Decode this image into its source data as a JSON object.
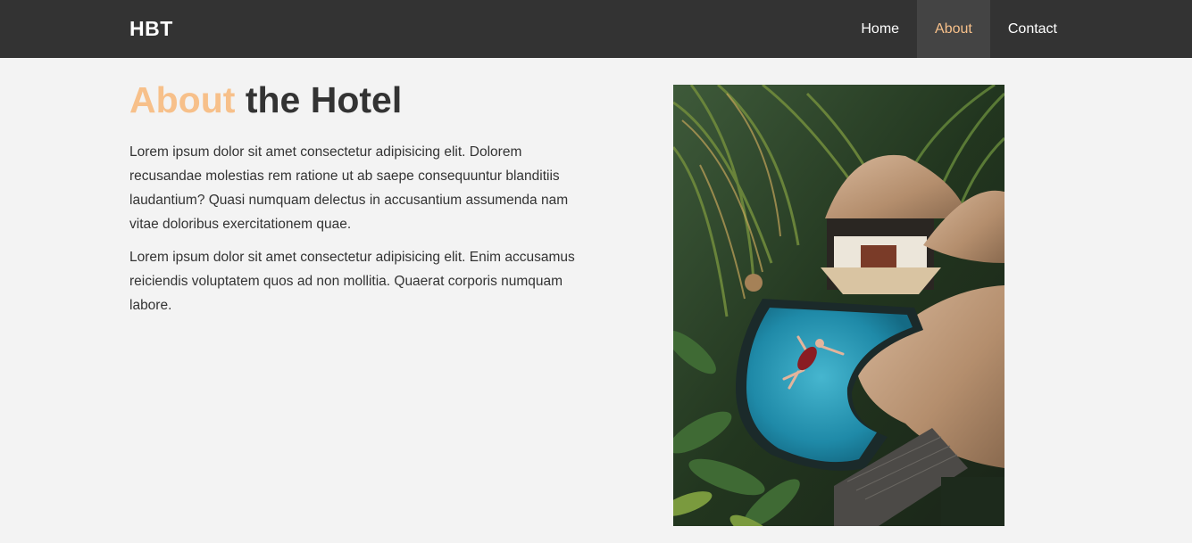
{
  "brand": "HBT",
  "nav": {
    "items": [
      {
        "label": "Home",
        "active": false
      },
      {
        "label": "About",
        "active": true
      },
      {
        "label": "Contact",
        "active": false
      }
    ]
  },
  "about": {
    "title_accent": "About",
    "title_rest": "the Hotel",
    "paragraphs": [
      "Lorem ipsum dolor sit amet consectetur adipisicing elit. Dolorem recusandae molestias rem ratione ut ab saepe consequuntur blanditiis laudantium? Quasi numquam delectus in accusantium assumenda nam vitae doloribus exercitationem quae.",
      "Lorem ipsum dolor sit amet consectetur adipisicing elit. Enim accusamus reiciendis voluptatem quos ad non mollitia. Quaerat corporis numquam labore."
    ]
  },
  "colors": {
    "navbar_bg": "#333333",
    "accent": "#f7c08a",
    "active_bg": "#444444",
    "page_bg": "#f3f3f3"
  }
}
